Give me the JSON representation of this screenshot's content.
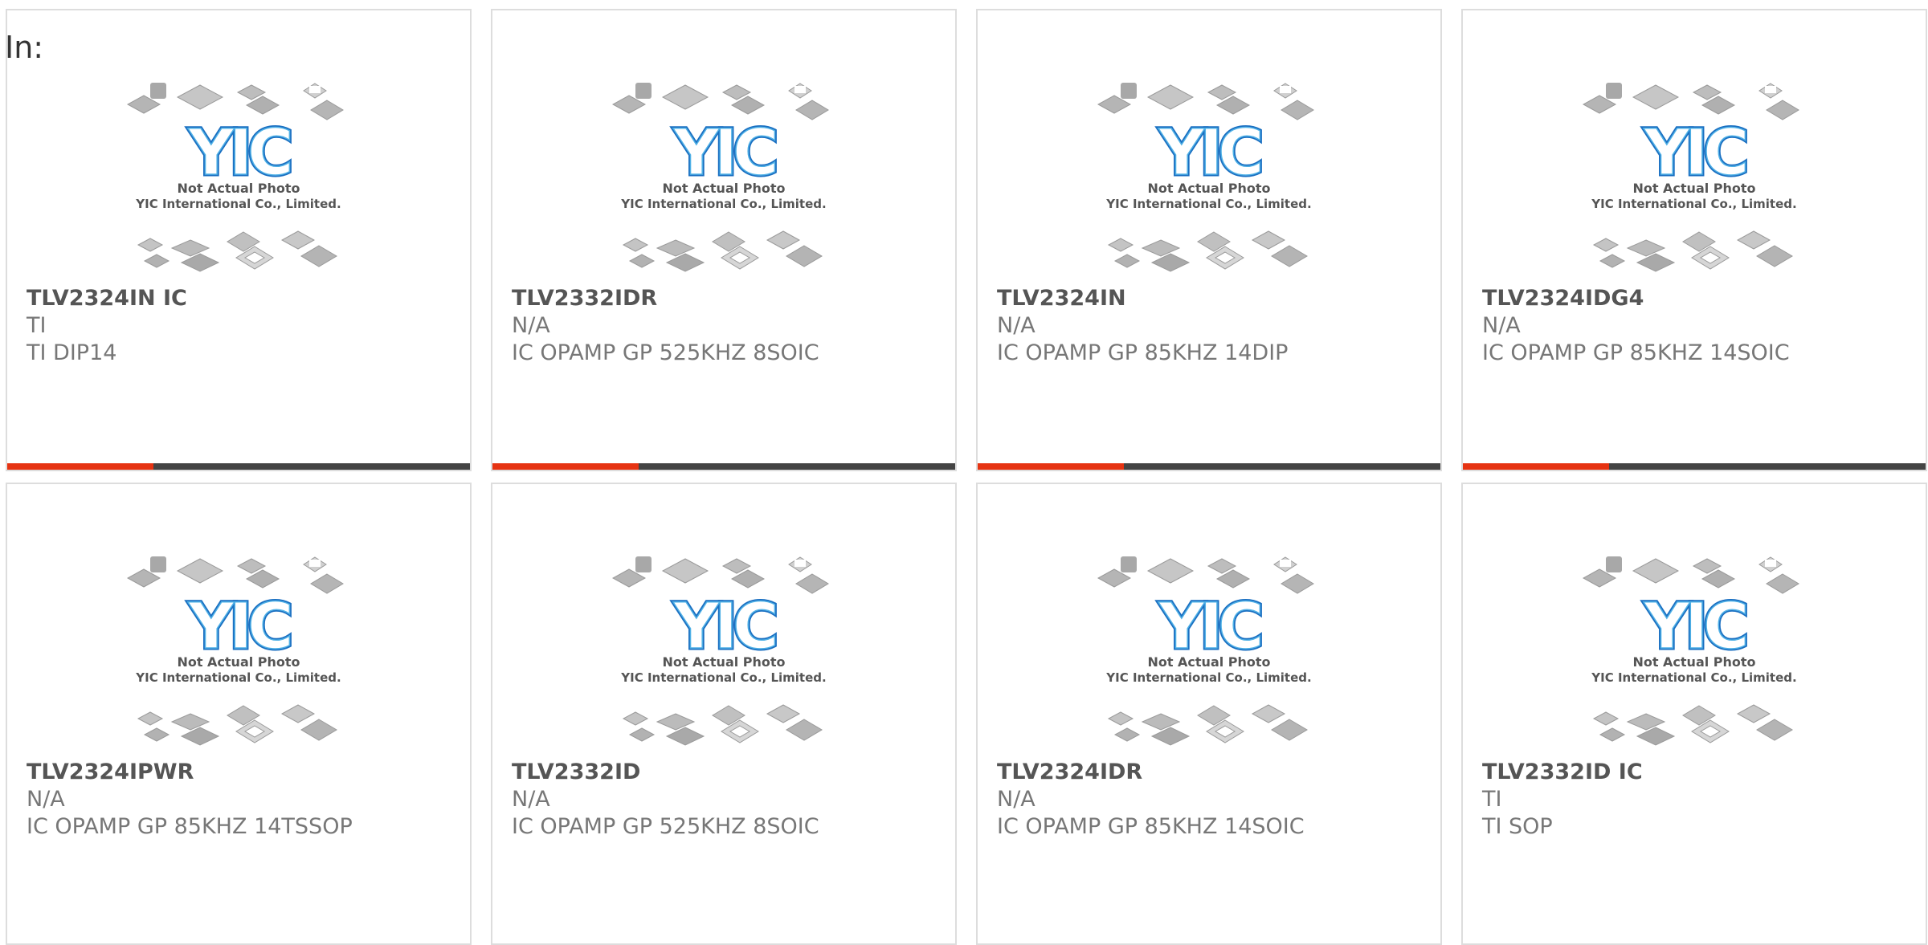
{
  "page": {
    "label": "In:"
  },
  "colors": {
    "accent": "#e63312",
    "bar": "#444444",
    "logo_blue": "#1a6fc1",
    "chip_gray": "#b5b5b5"
  },
  "placeholder_image": {
    "icon": "chip-placeholder-icon",
    "line1": "Not Actual Photo",
    "line2": "YIC International Co., Limited.",
    "logo_text": "YIC"
  },
  "products": [
    {
      "part": "TLV2324IN IC",
      "manufacturer": "TI",
      "description": "TI DIP14",
      "has_accent_bar": true
    },
    {
      "part": "TLV2332IDR",
      "manufacturer": "N/A",
      "description": "IC OPAMP GP 525KHZ 8SOIC",
      "has_accent_bar": true
    },
    {
      "part": "TLV2324IN",
      "manufacturer": "N/A",
      "description": "IC OPAMP GP 85KHZ 14DIP",
      "has_accent_bar": true
    },
    {
      "part": "TLV2324IDG4",
      "manufacturer": "N/A",
      "description": "IC OPAMP GP 85KHZ 14SOIC",
      "has_accent_bar": true
    },
    {
      "part": "TLV2324IPWR",
      "manufacturer": "N/A",
      "description": "IC OPAMP GP 85KHZ 14TSSOP",
      "has_accent_bar": false
    },
    {
      "part": "TLV2332ID",
      "manufacturer": "N/A",
      "description": "IC OPAMP GP 525KHZ 8SOIC",
      "has_accent_bar": false
    },
    {
      "part": "TLV2324IDR",
      "manufacturer": "N/A",
      "description": "IC OPAMP GP 85KHZ 14SOIC",
      "has_accent_bar": false
    },
    {
      "part": "TLV2332ID IC",
      "manufacturer": "TI",
      "description": "TI SOP",
      "has_accent_bar": false
    }
  ]
}
